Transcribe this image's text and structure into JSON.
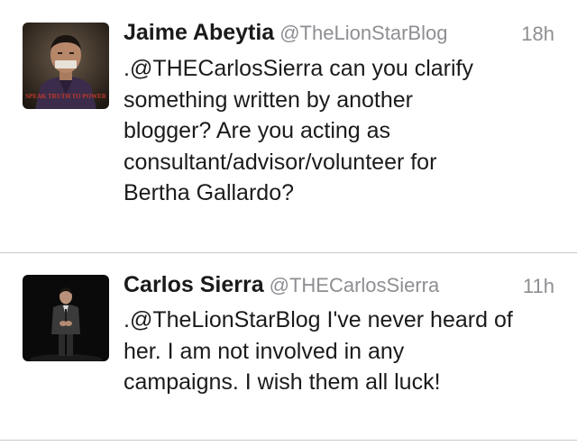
{
  "tweets": [
    {
      "name": "Jaime Abeytia",
      "handle": "@TheLionStarBlog",
      "time": "18h",
      "avatar_caption": "SPEAK TRUTH TO POWER",
      "lines": [
        ".@THECarlosSierra can you clarify",
        "something written by another",
        "blogger? Are you acting as",
        "consultant/advisor/volunteer for",
        "Bertha Gallardo?"
      ]
    },
    {
      "name": "Carlos Sierra",
      "handle": "@THECarlosSierra",
      "time": "11h",
      "lines": [
        ".@TheLionStarBlog I've never heard of",
        "her. I am not involved in any",
        "campaigns. I wish them all luck!"
      ]
    }
  ],
  "colors": {
    "name": "#1a1a1a",
    "meta": "#8e8e93",
    "divider": "#c8c7cc",
    "avatar_caption": "#c0392b"
  }
}
